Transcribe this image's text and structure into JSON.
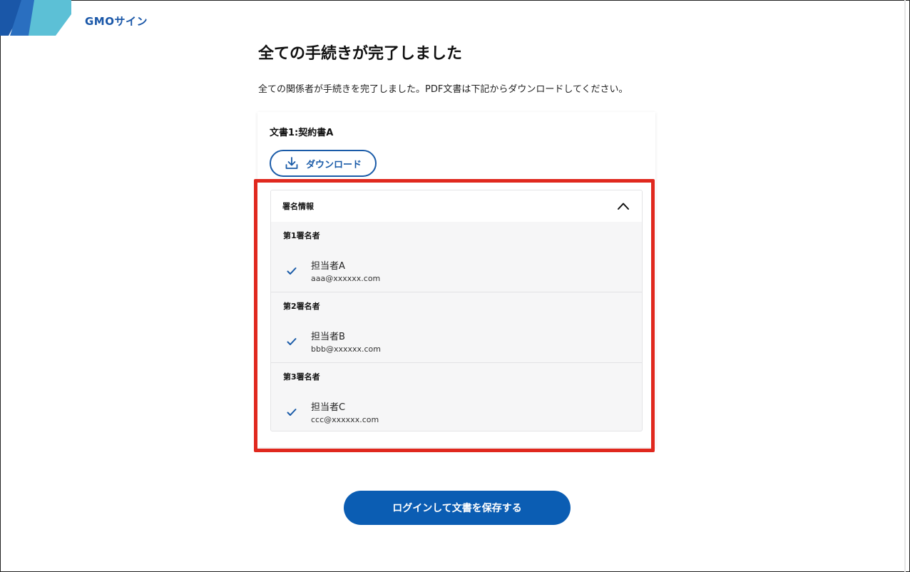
{
  "brand": {
    "logo_text": "GMOサイン"
  },
  "page": {
    "title": "全ての手続きが完了しました",
    "lead": "全ての関係者が手続きを完了しました。PDF文書は下記からダウンロードしてください。"
  },
  "document": {
    "label": "文書1:契約書A",
    "download_label": "ダウンロード"
  },
  "signature_info": {
    "title": "署名情報",
    "signers": [
      {
        "order": "第1署名者",
        "name": "担当者A",
        "email": "aaa@xxxxxx.com"
      },
      {
        "order": "第2署名者",
        "name": "担当者B",
        "email": "bbb@xxxxxx.com"
      },
      {
        "order": "第3署名者",
        "name": "担当者C",
        "email": "ccc@xxxxxx.com"
      }
    ]
  },
  "actions": {
    "save_label": "ログインして文書を保存する"
  },
  "colors": {
    "accent": "#0b5db3",
    "highlight": "#e0281e",
    "check": "#1a5ba8"
  }
}
